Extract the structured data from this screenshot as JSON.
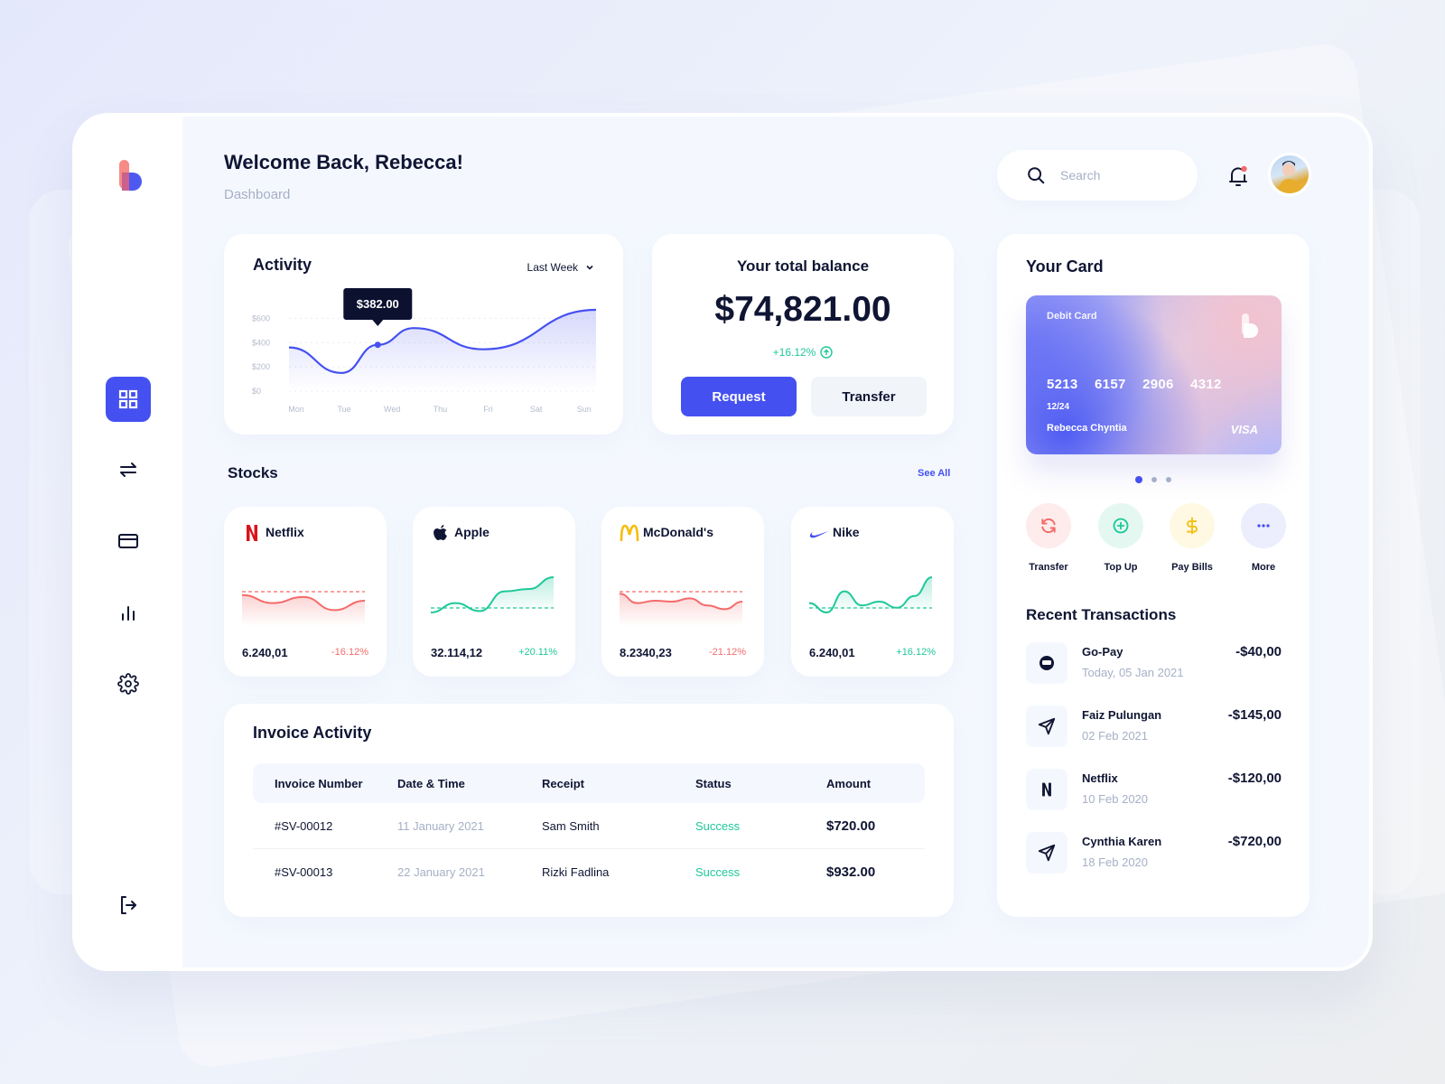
{
  "header": {
    "welcome": "Welcome Back, Rebecca!",
    "subtitle": "Dashboard",
    "search_placeholder": "Search"
  },
  "sidebar": {
    "items": [
      {
        "name": "dashboard",
        "icon": "grid-icon",
        "active": true
      },
      {
        "name": "transfers",
        "icon": "arrows-exchange-icon",
        "active": false
      },
      {
        "name": "cards",
        "icon": "credit-card-icon",
        "active": false
      },
      {
        "name": "statistics",
        "icon": "bar-chart-icon",
        "active": false
      },
      {
        "name": "settings",
        "icon": "gear-icon",
        "active": false
      }
    ],
    "logout_icon": "logout-icon"
  },
  "activity": {
    "title": "Activity",
    "period": "Last Week",
    "tooltip": "$382.00"
  },
  "chart_data": {
    "type": "area",
    "title": "Activity",
    "categories": [
      "Mon",
      "Tue",
      "Wed",
      "Thu",
      "Fri",
      "Sat",
      "Sun"
    ],
    "x": [
      0,
      1,
      2,
      3,
      4,
      5,
      6
    ],
    "values": [
      360,
      150,
      560,
      390,
      350,
      450,
      670
    ],
    "series_points": [
      {
        "x": -0.15,
        "y": 360
      },
      {
        "x": 0.95,
        "y": 150
      },
      {
        "x": 1.7,
        "y": 382
      },
      {
        "x": 2.45,
        "y": 520
      },
      {
        "x": 3.9,
        "y": 345
      },
      {
        "x": 6.25,
        "y": 670
      }
    ],
    "highlight": {
      "x": 1.7,
      "y": 382,
      "label": "$382.00"
    },
    "yticks": [
      "$600",
      "$400",
      "$200",
      "$0"
    ],
    "ytick_values": [
      600,
      400,
      200,
      0
    ],
    "ylim": [
      0,
      700
    ],
    "xlabel": "",
    "ylabel": "",
    "grid": true,
    "color": "#4550f0"
  },
  "balance": {
    "label": "Your total balance",
    "amount": "$74,821.00",
    "change": "+16.12%",
    "request": "Request",
    "transfer": "Transfer"
  },
  "stocks": {
    "title": "Stocks",
    "see_all": "See All",
    "items": [
      {
        "name": "Netflix",
        "value": "6.240,01",
        "change": "-16.12%",
        "trend": "down",
        "spark": [
          0.62,
          0.45,
          0.58,
          0.3,
          0.5
        ]
      },
      {
        "name": "Apple",
        "value": "32.114,12",
        "change": "+20.11%",
        "trend": "up",
        "spark": [
          0.25,
          0.45,
          0.28,
          0.7,
          0.75,
          1.0
        ]
      },
      {
        "name": "McDonald's",
        "value": "8.2340,23",
        "change": "-21.12%",
        "trend": "down",
        "spark": [
          0.65,
          0.45,
          0.5,
          0.48,
          0.55,
          0.4,
          0.32,
          0.48
        ]
      },
      {
        "name": "Nike",
        "value": "6.240,01",
        "change": "+16.12%",
        "trend": "up",
        "spark": [
          0.45,
          0.25,
          0.7,
          0.4,
          0.48,
          0.35,
          0.6,
          1.0
        ]
      }
    ]
  },
  "invoice": {
    "title": "Invoice Activity",
    "columns": [
      "Invoice Number",
      "Date & Time",
      "Receipt",
      "Status",
      "Amount"
    ],
    "rows": [
      [
        "#SV-00012",
        "11 January 2021",
        "Sam Smith",
        "Success",
        "$720.00"
      ],
      [
        "#SV-00013",
        "22 January 2021",
        "Rizki Fadlina",
        "Success",
        "$932.00"
      ]
    ]
  },
  "your_card": {
    "title": "Your Card",
    "type": "Debit Card",
    "number": "5213 6157 2906 4312",
    "expiry": "12/24",
    "holder": "Rebecca Chyntia",
    "network": "VISA",
    "pages": 3,
    "active_page": 0
  },
  "actions": [
    {
      "label": "Transfer",
      "icon": "refresh-icon",
      "color": "#f46b6b",
      "bg": "#fdeceb"
    },
    {
      "label": "Top Up",
      "icon": "plus-circle-icon",
      "color": "#1fc89a",
      "bg": "#e4f8f1"
    },
    {
      "label": "Pay Bills",
      "icon": "dollar-icon",
      "color": "#f5c218",
      "bg": "#fff8e3"
    },
    {
      "label": "More",
      "icon": "more-dots-icon",
      "color": "#4550f0",
      "bg": "#ecedfd"
    }
  ],
  "recent": {
    "title": "Recent Transactions",
    "items": [
      {
        "name": "Go-Pay",
        "date": "Today, 05 Jan 2021",
        "amount": "-$40,00",
        "icon": "wallet-icon"
      },
      {
        "name": "Faiz Pulungan",
        "date": "02 Feb 2021",
        "amount": "-$145,00",
        "icon": "send-icon"
      },
      {
        "name": "Netflix",
        "date": "10 Feb 2020",
        "amount": "-$120,00",
        "icon": "netflix-icon"
      },
      {
        "name": "Cynthia Karen",
        "date": "18 Feb 2020",
        "amount": "-$720,00",
        "icon": "send-icon"
      }
    ]
  },
  "colors": {
    "accent": "#4550f0",
    "positive": "#1fc89a",
    "negative": "#f46b6b",
    "text": "#0f1533",
    "muted": "#a5b0c6"
  }
}
